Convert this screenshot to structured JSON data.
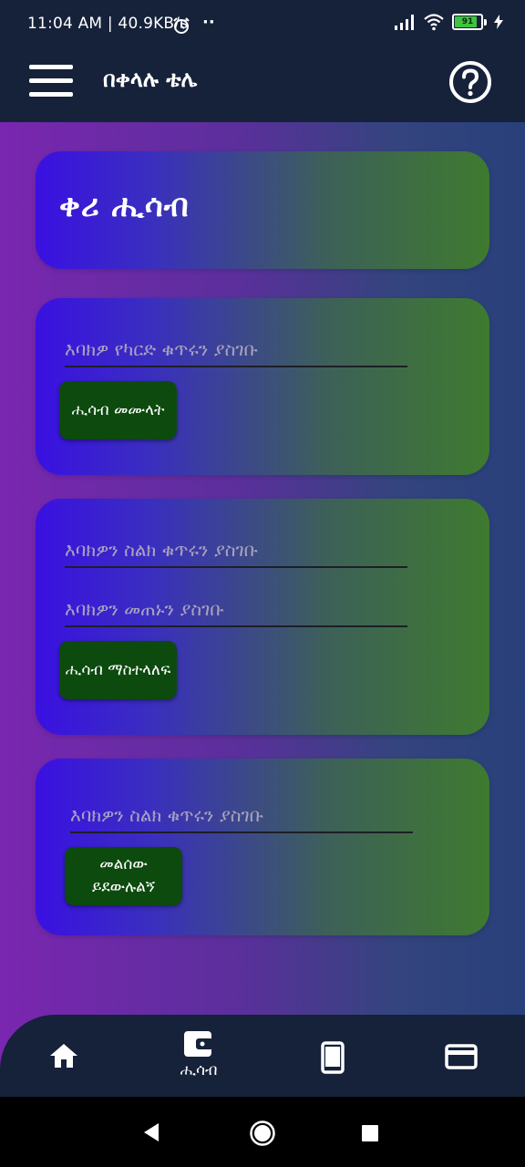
{
  "status": {
    "time": "11:04 AM | 40.9KB/s",
    "dots": "··",
    "battery": "91"
  },
  "app": {
    "title": "በቀላሉ ቴሌ"
  },
  "header_card": {
    "title": "ቀሪ  ሒሳብ"
  },
  "recharge_card": {
    "card_placeholder": "እባክዎ የካርድ ቁጥሩን ያስገቡ",
    "button_label": "ሒሳብ መሙላት"
  },
  "transfer_card": {
    "phone_placeholder": "እባክዎን ስልክ ቁጥሩን ያስገቡ",
    "amount_placeholder": "እባክዎን መጠኑን ያስገቡ",
    "button_label": "ሒሳብ ማስተላለፍ"
  },
  "callback_card": {
    "phone_placeholder": "እባክዎን ስልክ ቁጥሩን ያስገቡ",
    "button_line1": "መልሰው",
    "button_line2": "ይደውሉልኝ"
  },
  "bottom_nav": {
    "items": [
      {
        "icon": "home-icon",
        "label": ""
      },
      {
        "icon": "wallet-icon",
        "label": "ሒሳብ",
        "active": true
      },
      {
        "icon": "phone-icon",
        "label": ""
      },
      {
        "icon": "credit-card-icon",
        "label": ""
      }
    ]
  },
  "colors": {
    "bar": "#16213a",
    "button": "#0c4a0e",
    "card_left": "#3a10e2",
    "card_right": "#3e7a2f"
  }
}
